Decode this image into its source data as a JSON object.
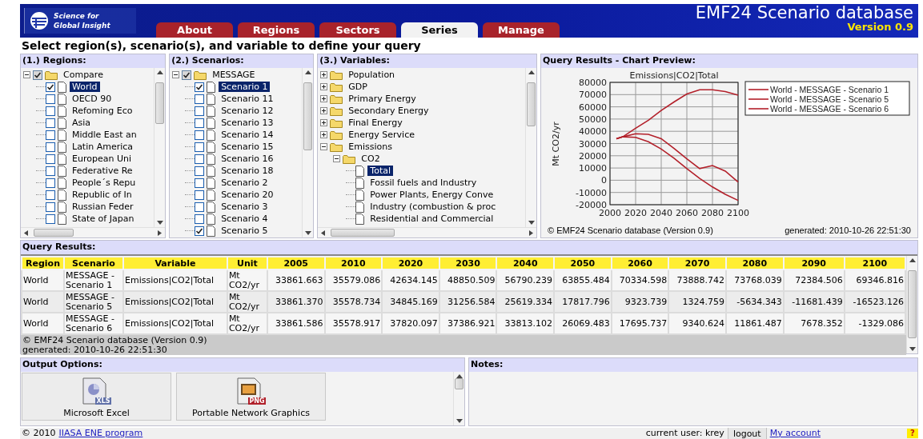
{
  "header": {
    "logo_lines": [
      "Science for",
      "Global Insight"
    ],
    "title": "EMF24 Scenario database",
    "version": "Version 0.9"
  },
  "tabs": [
    {
      "label": "About",
      "selected": false
    },
    {
      "label": "Regions",
      "selected": false
    },
    {
      "label": "Sectors",
      "selected": false
    },
    {
      "label": "Series",
      "selected": true
    },
    {
      "label": "Manage",
      "selected": false
    }
  ],
  "instruction": "Select region(s), scenario(s), and variable to define your query",
  "regions": {
    "title": "(1.) Regions:",
    "tree": [
      {
        "label": "Compare",
        "expanded": true,
        "checked": true,
        "children": [
          {
            "label": "World",
            "checked": true,
            "selected": true
          },
          {
            "label": "OECD 90",
            "checked": false,
            "selected": false
          },
          {
            "label": "Refoming Eco",
            "checked": false,
            "selected": false
          },
          {
            "label": "Asia",
            "checked": false,
            "selected": false
          },
          {
            "label": "Middle East an",
            "checked": false,
            "selected": false
          },
          {
            "label": "Latin America",
            "checked": false,
            "selected": false
          },
          {
            "label": "European Uni",
            "checked": false,
            "selected": false
          },
          {
            "label": "Federative Re",
            "checked": false,
            "selected": false
          },
          {
            "label": "People´s Repu",
            "checked": false,
            "selected": false
          },
          {
            "label": "Republic of In",
            "checked": false,
            "selected": false
          },
          {
            "label": "Russian Feder",
            "checked": false,
            "selected": false
          },
          {
            "label": "State of Japan",
            "checked": false,
            "selected": false
          }
        ]
      }
    ]
  },
  "scenarios": {
    "title": "(2.) Scenarios:",
    "tree": [
      {
        "label": "MESSAGE",
        "expanded": true,
        "checked": true,
        "children": [
          {
            "label": "Scenario 1",
            "checked": true,
            "selected": true
          },
          {
            "label": "Scenario 11",
            "checked": false,
            "selected": false
          },
          {
            "label": "Scenario 12",
            "checked": false,
            "selected": false
          },
          {
            "label": "Scenario 13",
            "checked": false,
            "selected": false
          },
          {
            "label": "Scenario 14",
            "checked": false,
            "selected": false
          },
          {
            "label": "Scenario 15",
            "checked": false,
            "selected": false
          },
          {
            "label": "Scenario 16",
            "checked": false,
            "selected": false
          },
          {
            "label": "Scenario 18",
            "checked": false,
            "selected": false
          },
          {
            "label": "Scenario 2",
            "checked": false,
            "selected": false
          },
          {
            "label": "Scenario 20",
            "checked": false,
            "selected": false
          },
          {
            "label": "Scenario 3",
            "checked": false,
            "selected": false
          },
          {
            "label": "Scenario 4",
            "checked": false,
            "selected": false
          },
          {
            "label": "Scenario 5",
            "checked": true,
            "selected": false
          }
        ]
      }
    ]
  },
  "variables": {
    "title": "(3.) Variables:",
    "tree": [
      {
        "label": "Population",
        "expanded": false
      },
      {
        "label": "GDP",
        "expanded": false
      },
      {
        "label": "Primary Energy",
        "expanded": false
      },
      {
        "label": "Secondary Energy",
        "expanded": false
      },
      {
        "label": "Final Energy",
        "expanded": false
      },
      {
        "label": "Energy Service",
        "expanded": false
      },
      {
        "label": "Emissions",
        "expanded": true,
        "children": [
          {
            "label": "CO2",
            "expanded": true,
            "children": [
              {
                "label": "Total",
                "selected": true
              },
              {
                "label": "Fossil fuels and Industry",
                "selected": false
              },
              {
                "label": "Power Plants, Energy Conve",
                "selected": false
              },
              {
                "label": "Industry (combustion & proc",
                "selected": false
              },
              {
                "label": "Residential and Commercial",
                "selected": false
              }
            ]
          }
        ]
      }
    ]
  },
  "chart_preview": {
    "title": "Query Results - Chart Preview:",
    "chart_data": {
      "type": "line",
      "title": "Emissions|CO2|Total",
      "ylabel": "Mt CO2/yr",
      "x": [
        2005,
        2010,
        2020,
        2030,
        2040,
        2050,
        2060,
        2070,
        2080,
        2090,
        2100
      ],
      "series": [
        {
          "name": "World - MESSAGE - Scenario 1",
          "color": "#b3202a",
          "values": [
            34000,
            35500,
            42500,
            49000,
            57000,
            64000,
            70500,
            74000,
            74000,
            72500,
            69500
          ]
        },
        {
          "name": "World - MESSAGE - Scenario 5",
          "color": "#b3202a",
          "values": [
            34000,
            35500,
            35000,
            31500,
            25500,
            18000,
            9500,
            1500,
            -5500,
            -11500,
            -16500
          ]
        },
        {
          "name": "World - MESSAGE - Scenario 6",
          "color": "#b3202a",
          "values": [
            34000,
            35500,
            38000,
            37500,
            34000,
            26000,
            17500,
            9500,
            12000,
            7500,
            -1500
          ]
        }
      ],
      "grid": true,
      "legend": "right",
      "xlim": [
        2000,
        2100
      ],
      "ylim": [
        -20000,
        80000
      ],
      "xticks": [
        2000,
        2020,
        2040,
        2060,
        2080,
        2100
      ],
      "yticks": [
        -20000,
        -10000,
        0,
        10000,
        20000,
        30000,
        40000,
        50000,
        60000,
        70000,
        80000
      ]
    },
    "copyright": "© EMF24 Scenario database (Version 0.9)",
    "generated": "generated: 2010-10-26 22:51:30"
  },
  "query_results": {
    "title": "Query Results:",
    "columns": [
      "Region",
      "Scenario",
      "Variable",
      "Unit",
      "2005",
      "2010",
      "2020",
      "2030",
      "2040",
      "2050",
      "2060",
      "2070",
      "2080",
      "2090",
      "2100"
    ],
    "rows": [
      {
        "cells": [
          "World",
          "MESSAGE - Scenario 1",
          "Emissions|CO2|Total",
          "Mt CO2/yr",
          "33861.663",
          "35579.086",
          "42634.145",
          "48850.509",
          "56790.239",
          "63855.484",
          "70334.598",
          "73888.742",
          "73768.039",
          "72384.506",
          "69346.816"
        ]
      },
      {
        "cells": [
          "World",
          "MESSAGE - Scenario 5",
          "Emissions|CO2|Total",
          "Mt CO2/yr",
          "33861.370",
          "35578.734",
          "34845.169",
          "31256.584",
          "25619.334",
          "17817.796",
          "9323.739",
          "1324.759",
          "-5634.343",
          "-11681.439",
          "-16523.126"
        ]
      },
      {
        "cells": [
          "World",
          "MESSAGE - Scenario 6",
          "Emissions|CO2|Total",
          "Mt CO2/yr",
          "33861.586",
          "35578.917",
          "37820.097",
          "37386.921",
          "33813.102",
          "26069.483",
          "17695.737",
          "9340.624",
          "11861.487",
          "7678.352",
          "-1329.086"
        ]
      }
    ],
    "footer": [
      "© EMF24 Scenario database (Version 0.9)",
      "generated: 2010-10-26 22:51:30"
    ]
  },
  "output_options": {
    "title": "Output Options:",
    "items": [
      {
        "label": "Microsoft Excel",
        "kind": "xls",
        "badge": "XLS"
      },
      {
        "label": "Portable Network Graphics",
        "kind": "png",
        "badge": "PNG"
      }
    ]
  },
  "notes": {
    "title": "Notes:"
  },
  "footer": {
    "copyright": "© 2010",
    "link": "IIASA ENE program",
    "user": "current user: krey",
    "logout": "logout",
    "account": "My account",
    "help": "?"
  }
}
